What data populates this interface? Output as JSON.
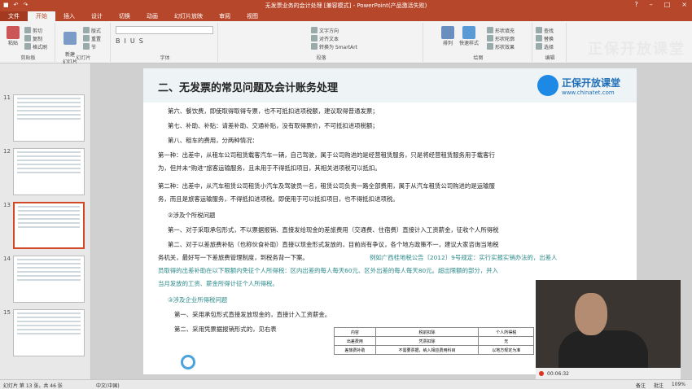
{
  "window": {
    "title": "无发票业务的会计处理 [兼容模式] - PowerPoint(产品激活失败)",
    "file_tab": "文件",
    "tabs": [
      "开始",
      "插入",
      "设计",
      "切换",
      "动画",
      "幻灯片放映",
      "审阅",
      "视图"
    ],
    "help_icon": "?",
    "brand_watermark": "正保开放课堂"
  },
  "ribbon": {
    "clipboard": {
      "paste": "粘贴",
      "cut": "剪切",
      "copy": "复制",
      "format_painter": "格式刷",
      "label": "剪贴板"
    },
    "slides": {
      "new_slide": "新建\n幻灯片",
      "layout": "版式",
      "reset": "重置",
      "section": "节",
      "label": "幻灯片"
    },
    "font": {
      "label": "字体"
    },
    "paragraph": {
      "text_direction": "文字方向",
      "align_text": "对齐文本",
      "smartart": "转换为 SmartArt",
      "label": "段落"
    },
    "drawing": {
      "arrange": "排列",
      "quick_styles": "快速样式",
      "fill": "形状填充",
      "outline": "形状轮廓",
      "effects": "形状效果",
      "label": "绘图"
    },
    "editing": {
      "find": "查找",
      "replace": "替换",
      "select": "选择",
      "label": "编辑"
    }
  },
  "thumbnails": [
    {
      "num": "11"
    },
    {
      "num": "12"
    },
    {
      "num": "13"
    },
    {
      "num": "14"
    },
    {
      "num": "15"
    }
  ],
  "slide": {
    "heading": "二、无发票的常见问题及会计账务处理",
    "logo_name": "正保开放课堂",
    "logo_url": "www.chinatet.com",
    "lines": [
      "第六、餐饮费，即使取得取得专票，也不可抵扣进项税额，建议取得普通发票；",
      "第七、补助、补贴：请差补助、交通补贴，没有取得票价，不可抵扣进项税额；",
      "第八、租车的费用，分两种情况：",
      "第一种：出差中，从租车公司租赁载客汽车一辆，自己驾驶，属于公司购进的是经营租赁服务，只是将经营租赁服务用于载客行",
      "为，但并未“购进”旅客运输服务，且未用于不得抵扣项目，其相关进项税可以抵扣。",
      "第二种：出差中，从汽车租赁公司租赁小汽车及驾驶员一名，租赁公司负责一路全部费用，属于从汽车租赁公司购进的是运输服",
      "务，而且是旅客运输服务，不得抵扣进项税。即使用于可以抵扣项目，也不得抵扣进项税。",
      "②涉及个所税问题",
      "第一、对于采取承包形式，不以票据报销、直接发给现金的差旅费用（交通费、住宿费）直接计入工资薪金，征收个人所得税",
      "第二、对于以差旅费补贴（也称伙食补助）直接以现金形式发放的，目前尚有争议，各个地方政策不一，建议大家咨询当地税",
      "务机关，最好写一下差旅费管理制度，到税务背一下案。",
      "例如广西桂地税公告〔2012〕9号规定：实行实报实销办法的，出差人",
      "员取得的出差补助在以下限额内免征个人所得税：区内出差的每人每天60元、区外出差的每人每天80元。超出限额的部分，并入",
      "当月发放的工资、薪金所得计征个人所得税。",
      "③涉及企业所得税问题",
      "第一、采用承包形式直接发放现金的，直接计入工资薪金。",
      "第二、采用凭票据报销形式的，见右表"
    ],
    "table": [
      [
        "内容",
        "税前扣除",
        "个人所得税"
      ],
      [
        "出差费用",
        "凭票扣除",
        "无"
      ],
      [
        "差旅费补助",
        "不需要票据，纳入相应费用科目",
        "以地方规定为准"
      ]
    ]
  },
  "video": {
    "time": "00:06:32"
  },
  "status": {
    "slide_info": "幻灯片 第 13 张，共 46 张",
    "lang": "中文(中国)",
    "notes": "备注",
    "comments": "批注",
    "zoom": "109%"
  }
}
